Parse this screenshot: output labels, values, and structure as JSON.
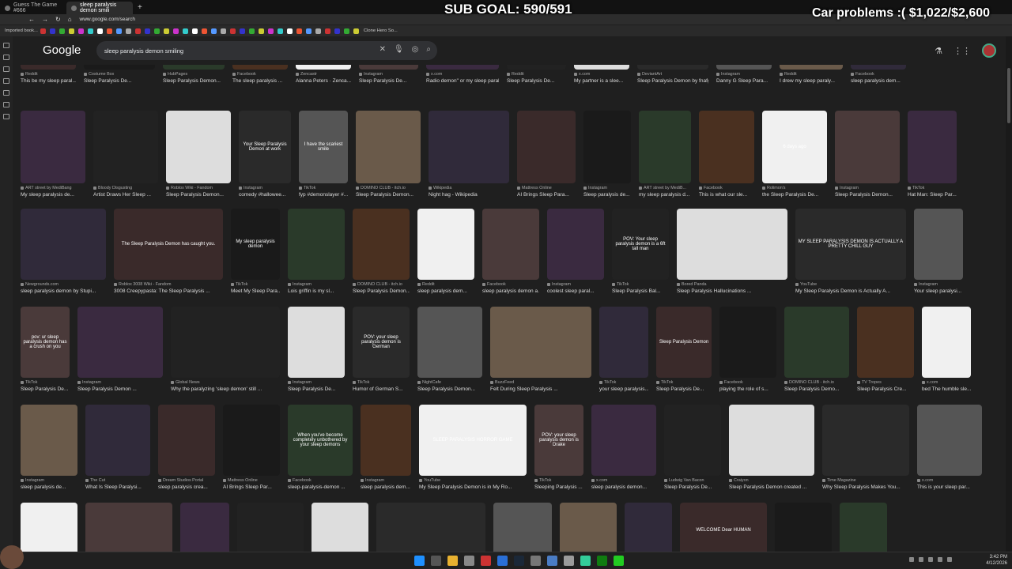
{
  "tabs": [
    {
      "label": "Guess The Game #666"
    },
    {
      "label": "sleep paralysis demon smili"
    }
  ],
  "overlay": {
    "sub_goal": "SUB GOAL: 590/591",
    "car": "Car problems :( $1,022/$2,600"
  },
  "url": "www.google.com/search",
  "bookmarks": {
    "first": "Imported book...",
    "last": "Clone Hero So..."
  },
  "google": {
    "logo": "Google",
    "query": "sleep paralysis demon smiling"
  },
  "rows": [
    {
      "items": [
        {
          "s": "Reddit",
          "t": "This be my sleep paral..."
        },
        {
          "s": "Costume Box",
          "t": "Sleep Paralysis De..."
        },
        {
          "s": "HubPages",
          "t": "Sleep Paralysis Demon..."
        },
        {
          "s": "Facebook",
          "t": "The sleep paralysis ..."
        },
        {
          "s": "Zencastr",
          "t": "Alanna Peters · Zenca..."
        },
        {
          "s": "Instagram",
          "t": "Sleep Paralysis De..."
        },
        {
          "s": "x.com",
          "t": "Radio demon\" or my sleep paralysis ..."
        },
        {
          "s": "Reddit",
          "t": "Sleep Paralysis De..."
        },
        {
          "s": "x.com",
          "t": "My partner is a slee..."
        },
        {
          "s": "DeviantArt",
          "t": "Sleep Paralysis Demon by fnafgarbage on ..."
        },
        {
          "s": "Instagram",
          "t": "Danny G Sleep Para..."
        },
        {
          "s": "Reddit",
          "t": "I drew my sleep paraly..."
        },
        {
          "s": "Facebook",
          "t": "sleep paralysis dem..."
        }
      ]
    },
    {
      "items": [
        {
          "s": "ART street by MediBang",
          "t": "My sleep paralysis de..."
        },
        {
          "s": "Bloody Disgusting",
          "t": "Artist Draws Her Sleep ..."
        },
        {
          "s": "Roblox Wiki - Fandom",
          "t": "Sleep Paralysis Demon..."
        },
        {
          "s": "Instagram",
          "t": "comedy #hallowee...",
          "o": "Your Sleep Paralysis Demon at work"
        },
        {
          "s": "TikTok",
          "t": "fyp #demonslayer #...",
          "o": "I have the scariest smile"
        },
        {
          "s": "DOMINO CLUB - itch.io",
          "t": "Sleep Paralysis Demon..."
        },
        {
          "s": "Wikipedia",
          "t": "Night hag - Wikipedia"
        },
        {
          "s": "Mattress Online",
          "t": "AI Brings Sleep Para..."
        },
        {
          "s": "Instagram",
          "t": "Sleep paralysis de..."
        },
        {
          "s": "ART street by MediB...",
          "t": "my sleep paralysis d..."
        },
        {
          "s": "Facebook",
          "t": "This is what our sle..."
        },
        {
          "s": "Rolimon's",
          "t": "the Sleep Paralysis De...",
          "o": "6 days ago"
        },
        {
          "s": "Instagram",
          "t": "Sleep Paralysis Demon..."
        },
        {
          "s": "TikTok",
          "t": "Hat Man: Sleep Par..."
        }
      ]
    },
    {
      "items": [
        {
          "s": "Newgrounds.com",
          "t": "sleep paralysis demon by Stupi..."
        },
        {
          "s": "Roblox 3008 Wiki - Fandom",
          "t": "3008 Creepypasta: The Sleep Paralysis ...",
          "o": "The Sleep Paralysis Demon has caught you."
        },
        {
          "s": "TikTok",
          "t": "Meet My Sleep Para...",
          "o": "My sleep paralysis demon"
        },
        {
          "s": "Instagram",
          "t": "Lois griffin is my sl..."
        },
        {
          "s": "DOMINO CLUB - itch.io",
          "t": "Sleep Paralysis Demon..."
        },
        {
          "s": "Reddit",
          "t": "sleep paralysis dem..."
        },
        {
          "s": "Facebook",
          "t": "sleep paralysis demon a..."
        },
        {
          "s": "Instagram",
          "t": "coolest sleep paral..."
        },
        {
          "s": "TikTok",
          "t": "Sleep Paralysis Bal...",
          "o": "POV: Your sleep paralysis demon is a 6ft tall man"
        },
        {
          "s": "Bored Panda",
          "t": "Sleep Paralysis Hallucinations ..."
        },
        {
          "s": "YouTube",
          "t": "My Sleep Paralysis Demon is Actually A...",
          "o": "MY SLEEP PARALYSIS DEMON IS ACTUALLY A PRETTY CHILL GUY"
        },
        {
          "s": "Instagram",
          "t": "Your sleep paralysi..."
        }
      ]
    },
    {
      "items": [
        {
          "s": "TikTok",
          "t": "Sleep Paralysis De...",
          "o": "pov: ur sleep paralysis demon has a crush on you"
        },
        {
          "s": "Instagram",
          "t": "Sleep Paralysis Demon ..."
        },
        {
          "s": "Global News",
          "t": "Why the paralyzing 'sleep demon' still ..."
        },
        {
          "s": "Instagram",
          "t": "Sleep Paralysis De..."
        },
        {
          "s": "TikTok",
          "t": "Humor of German S...",
          "o": "POV: your sleep paralysis demon is German"
        },
        {
          "s": "NightCafe",
          "t": "Sleep Paralysis Demon..."
        },
        {
          "s": "BuzzFeed",
          "t": "Felt During Sleep Paralysis ..."
        },
        {
          "s": "TikTok",
          "t": "your sleep paralysis..."
        },
        {
          "s": "TikTok",
          "t": "Sleep Paralysis De...",
          "o": "Sleep Paralysis Demon"
        },
        {
          "s": "Facebook",
          "t": "playing the role of s..."
        },
        {
          "s": "DOMINO CLUB - itch.io",
          "t": "Sleep Paralysis Demo..."
        },
        {
          "s": "TV Tropes",
          "t": "Sleep Paralysis Cre..."
        },
        {
          "s": "x.com",
          "t": "bed The humble sle..."
        }
      ]
    },
    {
      "items": [
        {
          "s": "Instagram",
          "t": "sleep paralysis de..."
        },
        {
          "s": "The Cut",
          "t": "What Is Sleep Paralysi..."
        },
        {
          "s": "Dream Studios Portal",
          "t": "sleep paralysis crea..."
        },
        {
          "s": "Mattress Online",
          "t": "AI Brings Sleep Par..."
        },
        {
          "s": "Facebook",
          "t": "sleep-paralysis-demon ...",
          "o": "When you've become completely unbothered by your sleep demons"
        },
        {
          "s": "Instagram",
          "t": "sleep paralysis dem..."
        },
        {
          "s": "YouTube",
          "t": "My Sleep Paralysis Demon is in My Ro...",
          "o": "SLEEP PARALYSIS HORROR GAME"
        },
        {
          "s": "TikTok",
          "t": "Sleeping Paralysis ...",
          "o": "POV: your sleep paralysis demon is Drake"
        },
        {
          "s": "x.com",
          "t": "sleep paralysis demon..."
        },
        {
          "s": "Ludwig Van Bacon",
          "t": "Sleep Paralysis De..."
        },
        {
          "s": "Craiyon",
          "t": "Sleep Paralysis Demon created ..."
        },
        {
          "s": "Time Magazine",
          "t": "Why Sleep Paralysis Makes You..."
        },
        {
          "s": "x.com",
          "t": "This is your sleep par..."
        }
      ]
    },
    {
      "items": [
        {
          "s": "",
          "t": ""
        },
        {
          "s": "",
          "t": ""
        },
        {
          "s": "",
          "t": ""
        },
        {
          "s": "",
          "t": ""
        },
        {
          "s": "",
          "t": ""
        },
        {
          "s": "",
          "t": ""
        },
        {
          "s": "",
          "t": ""
        },
        {
          "s": "",
          "t": ""
        },
        {
          "s": "",
          "t": ""
        },
        {
          "s": "",
          "t": "",
          "o": "WELCOME Dear HUMAN"
        },
        {
          "s": "",
          "t": ""
        },
        {
          "s": "",
          "t": ""
        }
      ]
    }
  ],
  "taskbar": {
    "time": "3:42 PM",
    "date": "4/12/2026"
  },
  "colors": {
    "bg": "#1f1f1f",
    "search_bg": "#303134",
    "text": "#e8eaed"
  }
}
